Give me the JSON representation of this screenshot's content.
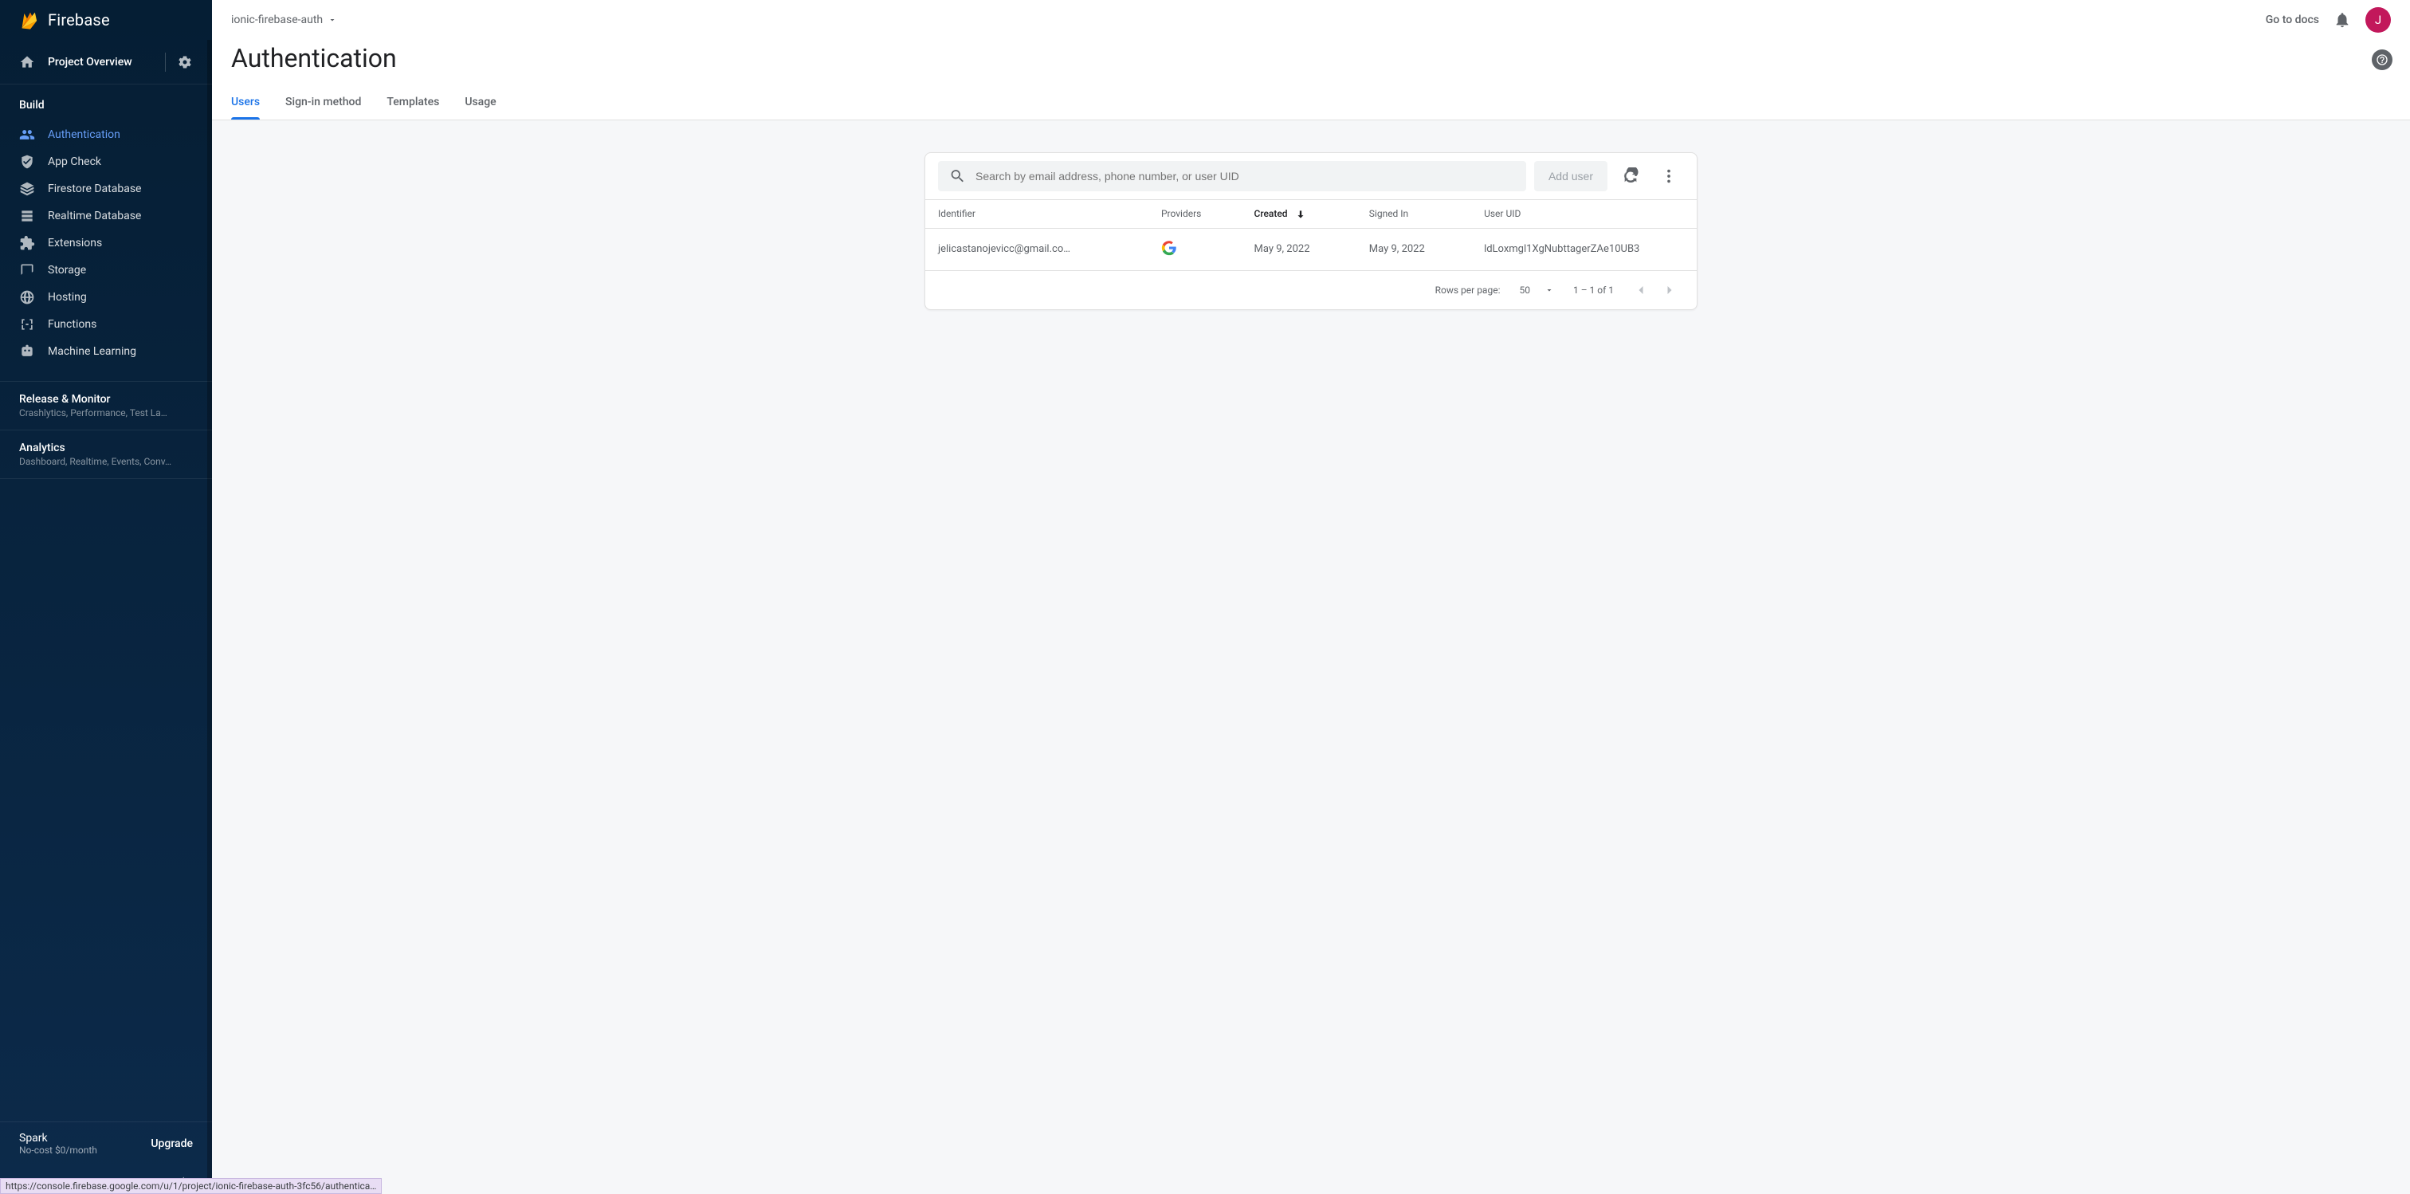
{
  "brand": {
    "name": "Firebase"
  },
  "sidebar": {
    "overview": "Project Overview",
    "build_label": "Build",
    "items": [
      {
        "label": "Authentication",
        "icon": "people"
      },
      {
        "label": "App Check",
        "icon": "shield"
      },
      {
        "label": "Firestore Database",
        "icon": "layers"
      },
      {
        "label": "Realtime Database",
        "icon": "database"
      },
      {
        "label": "Extensions",
        "icon": "puzzle"
      },
      {
        "label": "Storage",
        "icon": "folder"
      },
      {
        "label": "Hosting",
        "icon": "globe"
      },
      {
        "label": "Functions",
        "icon": "functions"
      },
      {
        "label": "Machine Learning",
        "icon": "robot"
      }
    ],
    "release": {
      "title": "Release & Monitor",
      "sub": "Crashlytics, Performance, Test La…"
    },
    "analytics": {
      "title": "Analytics",
      "sub": "Dashboard, Realtime, Events, Conv…"
    },
    "plan": {
      "name": "Spark",
      "sub": "No-cost $0/month",
      "upgrade": "Upgrade"
    }
  },
  "topbar": {
    "project": "ionic-firebase-auth",
    "docs": "Go to docs",
    "avatar_initial": "J"
  },
  "page": {
    "title": "Authentication",
    "tabs": [
      "Users",
      "Sign-in method",
      "Templates",
      "Usage"
    ],
    "active_tab": 0
  },
  "users_card": {
    "search_placeholder": "Search by email address, phone number, or user UID",
    "add_user": "Add user",
    "columns": [
      "Identifier",
      "Providers",
      "Created",
      "Signed In",
      "User UID"
    ],
    "sorted_col": 2,
    "rows": [
      {
        "identifier": "jelicastanojevicc@gmail.co…",
        "provider": "google",
        "created": "May 9, 2022",
        "signed_in": "May 9, 2022",
        "uid": "ldLoxmgl1XgNubttagerZAe10UB3"
      }
    ],
    "pagination": {
      "rpp_label": "Rows per page:",
      "rpp_value": "50",
      "range": "1 – 1 of 1"
    }
  },
  "status_url": "https://console.firebase.google.com/u/1/project/ionic-firebase-auth-3fc56/authentica…"
}
